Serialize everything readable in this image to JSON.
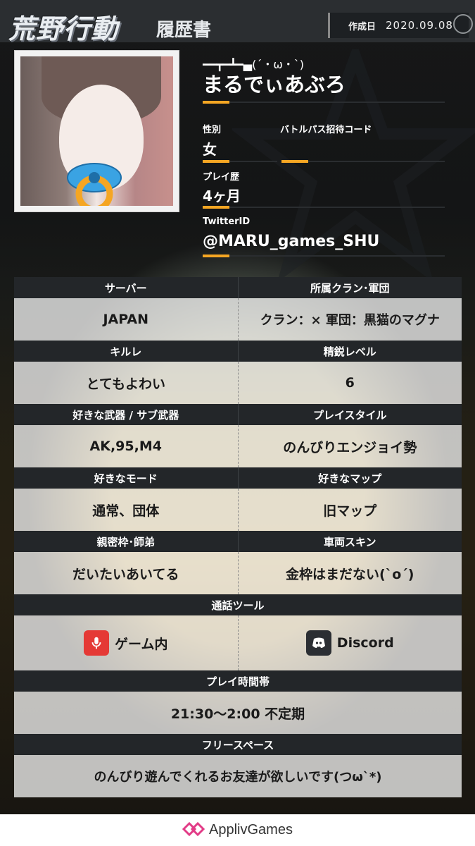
{
  "header": {
    "logo": "荒野行動",
    "subtitle": "履歴書",
    "date_label": "作成日",
    "date_value": "2020.09.08"
  },
  "profile": {
    "kaomoji": "━━┳━┻━▄(´・ω・`)",
    "name": "まるでぃあぶろ",
    "gender_label": "性別",
    "gender_value": "女",
    "invite_label": "バトルパス招待コード",
    "invite_value": "",
    "history_label": "プレイ歴",
    "history_value": "4ヶ月",
    "twitter_label": "TwitterID",
    "twitter_value": "@MARU_games_SHU"
  },
  "table": {
    "server_label": "サーバー",
    "server_value": "JAPAN",
    "clan_label": "所属クラン･軍団",
    "clan_value": "クラン：×  軍団：黒猫のマグナ",
    "killratio_label": "キルレ",
    "killratio_value": "とてもよわい",
    "elite_label": "精鋭レベル",
    "elite_value": "6",
    "weapon_label": "好きな武器 / サブ武器",
    "weapon_value": "AK,95,M4",
    "style_label": "プレイスタイル",
    "style_value": "のんびりエンジョイ勢",
    "mode_label": "好きなモード",
    "mode_value": "通常、団体",
    "map_label": "好きなマップ",
    "map_value": "旧マップ",
    "close_label": "親密枠･師弟",
    "close_value": "だいたいあいてる",
    "skin_label": "車両スキン",
    "skin_value": "金枠はまだない(`o´)",
    "call_label": "通話ツール",
    "call_tool1": "ゲーム内",
    "call_tool2": "Discord",
    "time_label": "プレイ時間帯",
    "time_value": "21:30～2:00 不定期",
    "free_label": "フリースペース",
    "free_value": "のんびり遊んでくれるお友達が欲しいです(つω`*)"
  },
  "footer": {
    "brand": "ApplivGames"
  },
  "colors": {
    "accent": "#f5a623",
    "header_bar": "#232629",
    "mic_red": "#e53935",
    "discord_dark": "#2b2e33"
  },
  "icons": {
    "mic": "microphone-icon",
    "discord": "discord-icon",
    "brand": "applivgames-logo-icon"
  }
}
